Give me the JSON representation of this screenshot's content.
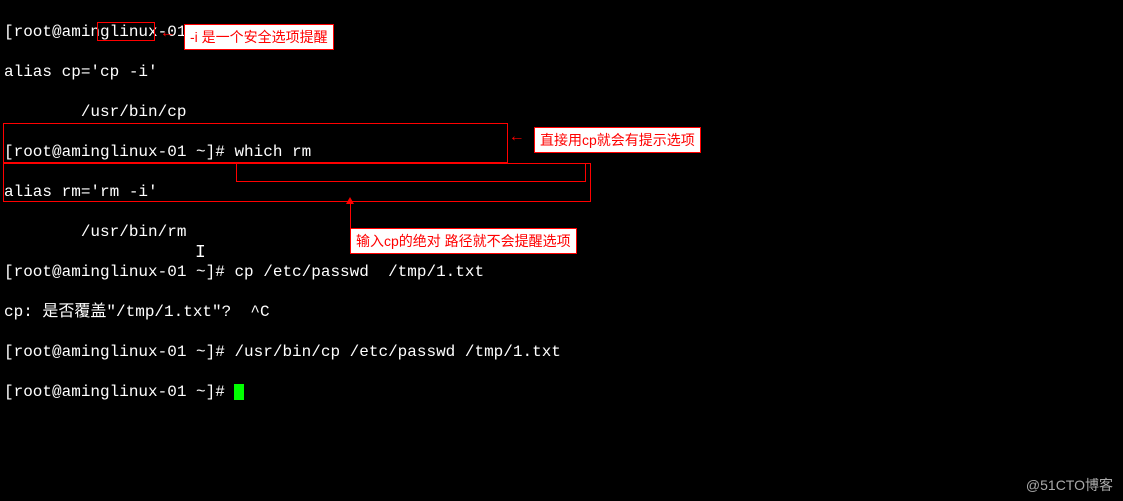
{
  "terminal": {
    "line1": "[root@aminglinux-01 ~]# which cp",
    "line2a": "alias cp='",
    "line2b": "cp -i",
    "line2c": "'",
    "line3": "        /usr/bin/cp",
    "line4": "[root@aminglinux-01 ~]# which rm",
    "line5": "alias rm='rm -i'",
    "line6": "        /usr/bin/rm",
    "line7": "[root@aminglinux-01 ~]# cp /etc/passwd  /tmp/1.txt",
    "line8": "cp: 是否覆盖\"/tmp/1.txt\"?  ^C",
    "line9a": "[root@aminglinux-01 ~]# ",
    "line9b": "/usr/bin/cp /etc/passwd /tmp/1.txt",
    "line10": "[root@aminglinux-01 ~]# "
  },
  "annotations": {
    "a1": "-i 是一个安全选项提醒",
    "a2": "直接用cp就会有提示选项",
    "a3": "输入cp的绝对 路径就不会提醒选项"
  },
  "watermark": "@51CTO博客"
}
